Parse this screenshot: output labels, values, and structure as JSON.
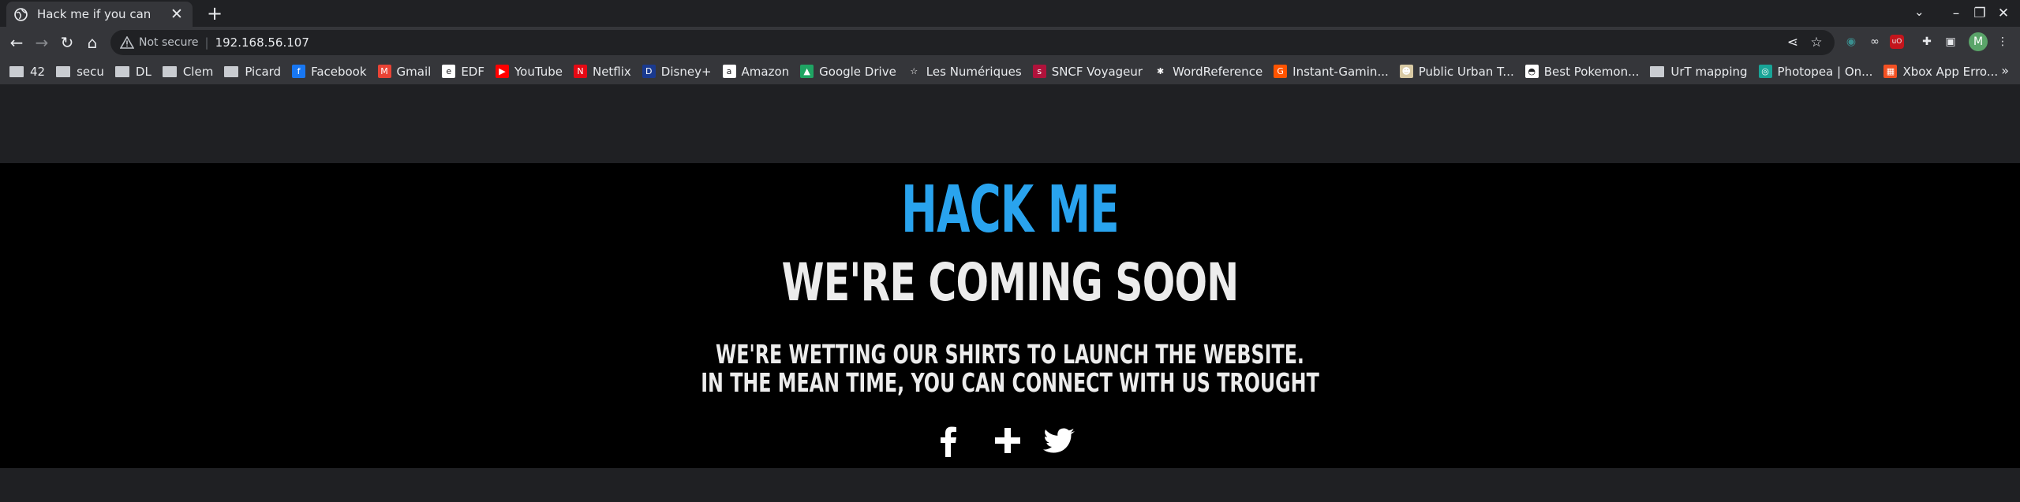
{
  "browser": {
    "tab_title": "Hack me if you can",
    "new_tab_symbol": "+",
    "tab_close_symbol": "✕",
    "omnibox": {
      "security_label": "Not secure",
      "separator": "|",
      "url": "192.168.56.107"
    },
    "profile_initial": "M",
    "bookmarks": [
      {
        "label": "42",
        "icon": "folder-icon"
      },
      {
        "label": "secu",
        "icon": "folder-icon"
      },
      {
        "label": "DL",
        "icon": "folder-icon"
      },
      {
        "label": "Clem",
        "icon": "folder-icon"
      },
      {
        "label": "Picard",
        "icon": "folder-icon"
      },
      {
        "label": "Facebook",
        "icon": "facebook-icon",
        "color": "#1877f2",
        "glyph": "f"
      },
      {
        "label": "Gmail",
        "icon": "gmail-icon",
        "color": "#ea4335",
        "glyph": "M"
      },
      {
        "label": "EDF",
        "icon": "edf-icon",
        "color": "#ffffff",
        "glyph": "e"
      },
      {
        "label": "YouTube",
        "icon": "youtube-icon",
        "color": "#ff0000",
        "glyph": "▶"
      },
      {
        "label": "Netflix",
        "icon": "netflix-icon",
        "color": "#e50914",
        "glyph": "N"
      },
      {
        "label": "Disney+",
        "icon": "disney-icon",
        "color": "#1a3a8f",
        "glyph": "D"
      },
      {
        "label": "Amazon",
        "icon": "amazon-icon",
        "color": "#ffffff",
        "glyph": "a"
      },
      {
        "label": "Google Drive",
        "icon": "google-drive-icon",
        "color": "#1fa463",
        "glyph": "▲"
      },
      {
        "label": "Les Numériques",
        "icon": "star-icon",
        "color": "#35363a",
        "glyph": "☆"
      },
      {
        "label": "SNCF Voyageur",
        "icon": "sncf-icon",
        "color": "#b0123b",
        "glyph": "s"
      },
      {
        "label": "WordReference",
        "icon": "wordreference-icon",
        "color": "#35363a",
        "glyph": "✱"
      },
      {
        "label": "Instant-Gamin...",
        "icon": "instant-gaming-icon",
        "color": "#ff5400",
        "glyph": "G"
      },
      {
        "label": "Public Urban T...",
        "icon": "urban-terror-icon",
        "color": "#d8c9a3",
        "glyph": "☻"
      },
      {
        "label": "Best Pokemon...",
        "icon": "pokeball-icon",
        "color": "#ffffff",
        "glyph": "◓"
      },
      {
        "label": "UrT mapping",
        "icon": "folder-icon"
      },
      {
        "label": "Photopea | On...",
        "icon": "photopea-icon",
        "color": "#18a497",
        "glyph": "◎"
      },
      {
        "label": "Xbox App Erro...",
        "icon": "microsoft-icon",
        "color": "#f25022",
        "glyph": "▦"
      }
    ]
  },
  "page": {
    "brand": "HACK ME",
    "headline": "WE'RE COMING SOON",
    "subline_1": "WE'RE WETTING OUR SHIRTS TO LAUNCH THE WEBSITE.",
    "subline_2": "IN THE MEAN TIME, YOU CAN CONNECT WITH US TROUGHT",
    "socials": [
      {
        "name": "facebook-link",
        "icon": "facebook-icon"
      },
      {
        "name": "google-plus-link",
        "icon": "plus-icon"
      },
      {
        "name": "twitter-link",
        "icon": "twitter-icon"
      }
    ],
    "colors": {
      "brand": "#29a3ee",
      "text": "#ececec",
      "hero_bg": "#000000"
    }
  }
}
